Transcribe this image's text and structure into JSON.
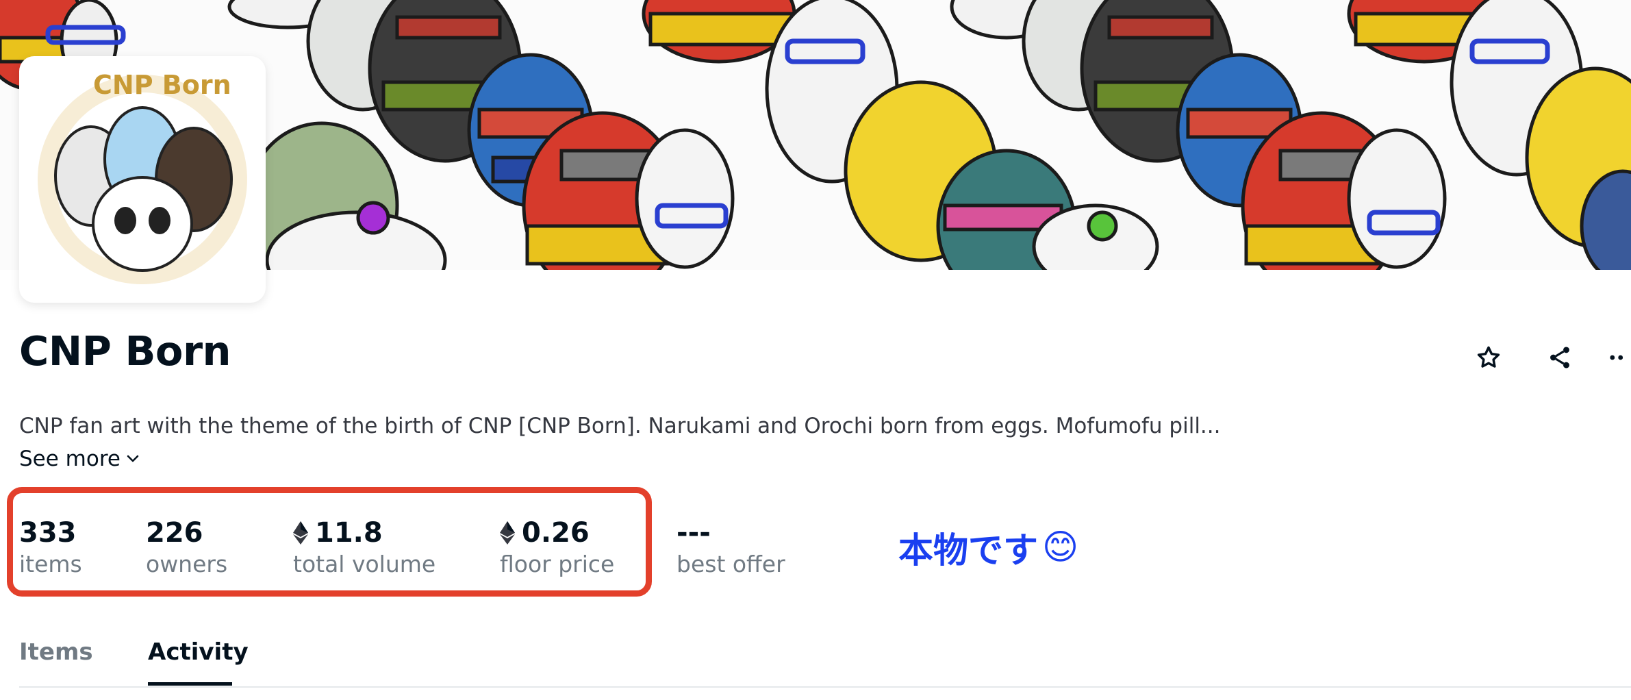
{
  "collection": {
    "name": "CNP Born",
    "avatar_text": "CNP Born",
    "description": "CNP fan art with the theme of the birth of CNP [CNP Born]. Narukami and Orochi born from eggs. Mofumofu pill...",
    "see_more_label": "See more"
  },
  "stats": [
    {
      "value": "333",
      "label": "items",
      "eth": false
    },
    {
      "value": "226",
      "label": "owners",
      "eth": false
    },
    {
      "value": "11.8",
      "label": "total volume",
      "eth": true
    },
    {
      "value": "0.26",
      "label": "floor price",
      "eth": true
    },
    {
      "value": "---",
      "label": "best offer",
      "eth": false
    }
  ],
  "annotation": {
    "text": "本物です",
    "emoji": "😊",
    "color": "#1a3ff0",
    "highlight_color": "#e3402b"
  },
  "tabs": [
    {
      "label": "Items",
      "active": false
    },
    {
      "label": "Activity",
      "active": true
    }
  ],
  "actions": {
    "icons": [
      "star-icon",
      "share-icon",
      "more-icon"
    ]
  }
}
